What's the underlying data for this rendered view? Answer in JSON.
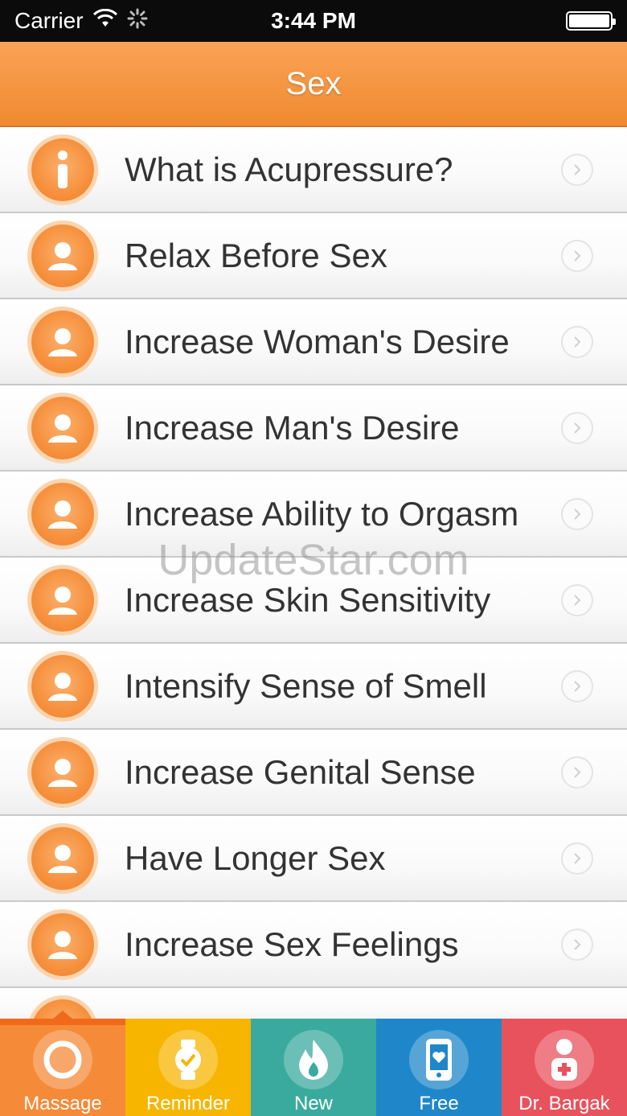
{
  "status_bar": {
    "carrier": "Carrier",
    "time": "3:44 PM",
    "wifi_icon": "wifi-icon",
    "activity_icon": "activity-spinner-icon",
    "battery_icon": "battery-icon"
  },
  "nav": {
    "title": "Sex"
  },
  "list": {
    "items": [
      {
        "label": "What is Acupressure?",
        "icon": "info-icon"
      },
      {
        "label": "Relax Before Sex",
        "icon": "person-icon"
      },
      {
        "label": "Increase Woman's Desire",
        "icon": "person-icon"
      },
      {
        "label": "Increase Man's Desire",
        "icon": "person-icon"
      },
      {
        "label": "Increase Ability to Orgasm",
        "icon": "person-icon"
      },
      {
        "label": "Increase Skin Sensitivity",
        "icon": "person-icon"
      },
      {
        "label": "Intensify Sense of Smell",
        "icon": "person-icon"
      },
      {
        "label": "Increase Genital Sense",
        "icon": "person-icon"
      },
      {
        "label": "Have Longer Sex",
        "icon": "person-icon"
      },
      {
        "label": "Increase Sex Feelings",
        "icon": "person-icon"
      }
    ]
  },
  "watermark": "UpdateStar.com",
  "tabs": [
    {
      "label": "Massage",
      "icon": "target-icon",
      "color": "#f58a38",
      "selected": true
    },
    {
      "label": "Reminder",
      "icon": "watch-icon",
      "color": "#f7b500"
    },
    {
      "label": "New",
      "icon": "flame-icon",
      "color": "#3aaa9e"
    },
    {
      "label": "Free",
      "icon": "phone-heart-icon",
      "color": "#1f87c9"
    },
    {
      "label": "Dr. Bargak",
      "icon": "doctor-icon",
      "color": "#e8525c"
    }
  ],
  "colors": {
    "accent": "#f58a38",
    "nav_top": "#f9a355",
    "nav_bottom": "#f08a30"
  }
}
